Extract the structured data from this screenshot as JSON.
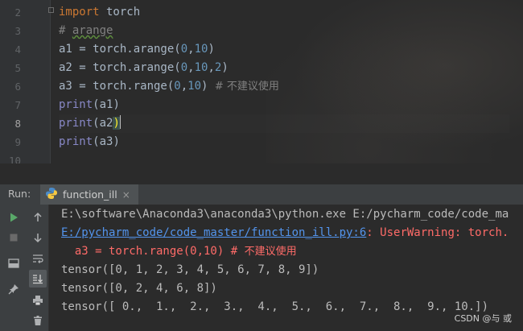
{
  "editor": {
    "line_numbers": [
      "2",
      "3",
      "4",
      "5",
      "6",
      "7",
      "8",
      "9",
      "10"
    ],
    "active_line": "8",
    "lines": {
      "l2": {
        "kw": "import",
        "rest": " torch"
      },
      "l3": {
        "comment_hash": "# ",
        "comment_word": "arange"
      },
      "l4": {
        "a": "a1 = torch.arange(",
        "n1": "0",
        "c": ",",
        "n2": "10",
        "b": ")"
      },
      "l5": {
        "a": "a2 = torch.arange(",
        "n1": "0",
        "c1": ",",
        "n2": "10",
        "c2": ",",
        "n3": "2",
        "b": ")"
      },
      "l6": {
        "a": "a3 = torch.range(",
        "n1": "0",
        "c": ",",
        "n2": "10",
        "b": ") ",
        "comment": "# 不建议使用"
      },
      "l7": {
        "fn": "print",
        "rest": "(a1)"
      },
      "l8": {
        "fn": "print",
        "open": "(",
        "arg": "a2",
        "close": ")"
      },
      "l9": {
        "fn": "print",
        "rest": "(a3)"
      }
    }
  },
  "run_window": {
    "label": "Run:",
    "tab_label": "function_ill",
    "tab_close": "×"
  },
  "console": {
    "line1": "E:\\software\\Anaconda3\\anaconda3\\python.exe E:/pycharm_code/code_ma",
    "line2_link": "E:/pycharm_code/code_master/function_ill.py:6",
    "line2_rest": ": UserWarning: torch.",
    "line3_code": "  a3 = torch.range(0,10) # ",
    "line3_cn": "不建议使用",
    "line4": "tensor([0, 1, 2, 3, 4, 5, 6, 7, 8, 9])",
    "line5": "tensor([0, 2, 4, 6, 8])",
    "line6": "tensor([ 0.,  1.,  2.,  3.,  4.,  5.,  6.,  7.,  8.,  9., 10.])"
  },
  "watermark": "CSDN @与 或",
  "colors": {
    "editor_bg": "#2b2b2b",
    "keyword": "#cc7832",
    "number": "#6897bb",
    "builtin": "#8888c6",
    "comment": "#808080",
    "error": "#ff6b68",
    "link": "#5394ec",
    "run_green": "#59a869"
  }
}
